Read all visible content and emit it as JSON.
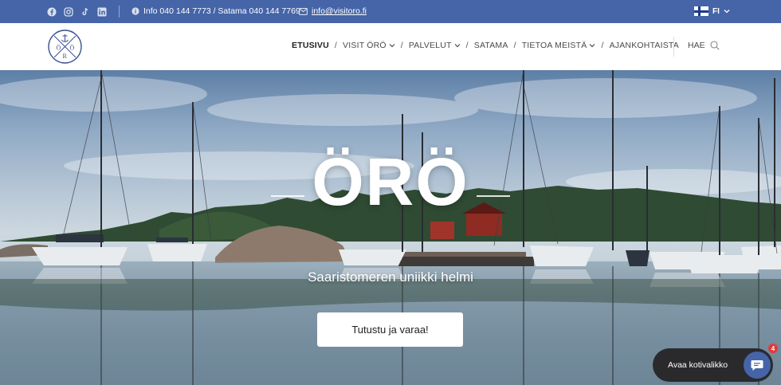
{
  "topbar": {
    "social_icons": [
      "facebook-icon",
      "instagram-icon",
      "tiktok-icon",
      "linkedin-icon"
    ],
    "info_text": "Info 040 144 7773 / Satama 040 144 7769",
    "email": "info@visitoro.fi",
    "language": "FI",
    "background_color": "#4565a8"
  },
  "nav": {
    "logo_letters": [
      "Ö",
      "R",
      "Ö"
    ],
    "items": [
      {
        "label": "ETUSIVU",
        "active": true
      },
      {
        "label": "VISIT ÖRÖ",
        "dropdown": true
      },
      {
        "label": "PALVELUT",
        "dropdown": true
      },
      {
        "label": "SATAMA"
      },
      {
        "label": "TIETOA MEISTÄ",
        "dropdown": true
      },
      {
        "label": "AJANKOHTAISTA"
      }
    ],
    "separator": "/",
    "search_label": "HAE"
  },
  "hero": {
    "title": "ÖRÖ",
    "subtitle": "Saaristomeren uniikki helmi",
    "cta_label": "Tutustu ja varaa!"
  },
  "chat": {
    "label": "Avaa kotivalikko",
    "badge_count": "4"
  }
}
